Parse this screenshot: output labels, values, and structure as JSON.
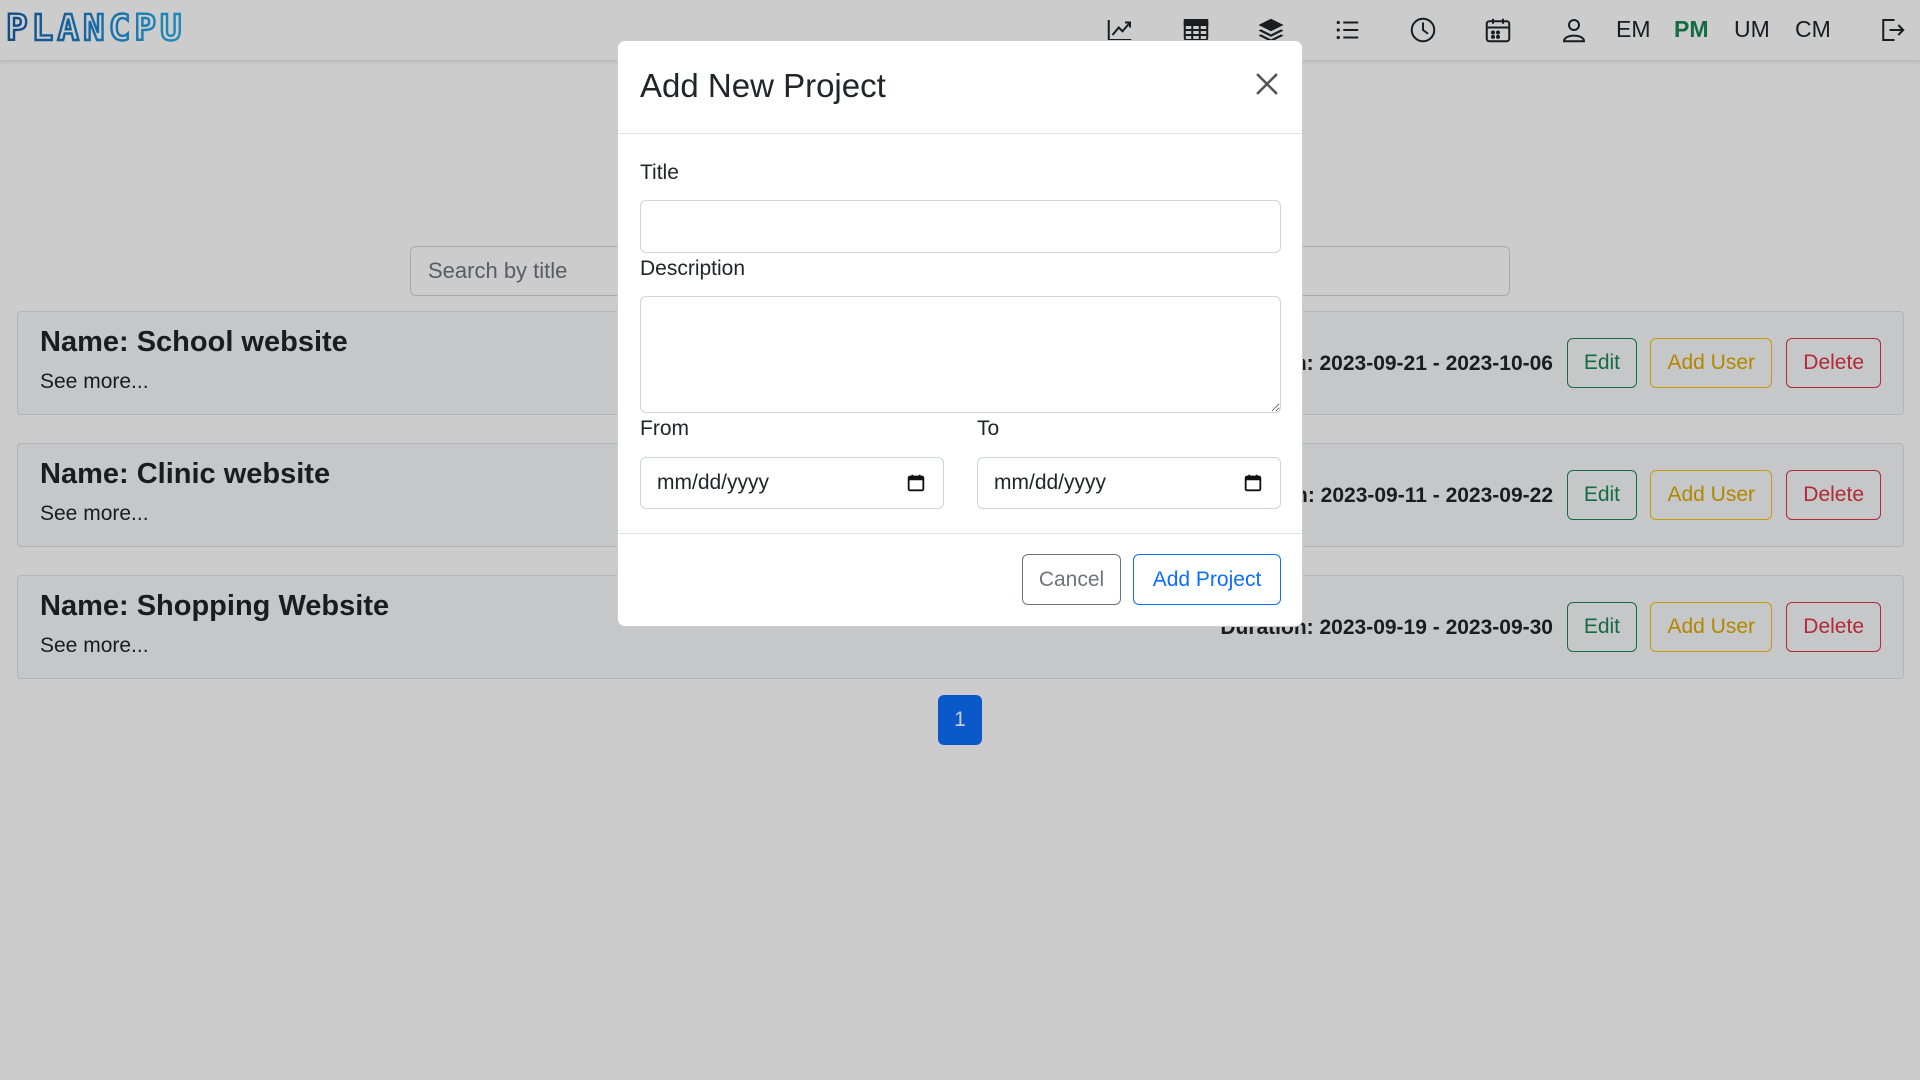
{
  "navbar": {
    "logo_text": "PLANCPU",
    "icons": [
      "chart-line-icon",
      "table-icon",
      "layers-icon",
      "list-icon",
      "clock-icon",
      "calendar-icon",
      "user-icon"
    ],
    "roles": [
      "EM",
      "PM",
      "UM",
      "CM"
    ],
    "active_role": "PM",
    "logout_icon": "logout-icon"
  },
  "search": {
    "placeholder": "Search by title"
  },
  "projects": [
    {
      "name": "Name: School website",
      "more": "See more...",
      "duration": "Duration: 2023-09-21 - 2023-10-06",
      "edit": "Edit",
      "add_user": "Add User",
      "delete": "Delete"
    },
    {
      "name": "Name: Clinic website",
      "more": "See more...",
      "duration": "Duration: 2023-09-11 - 2023-09-22",
      "edit": "Edit",
      "add_user": "Add User",
      "delete": "Delete"
    },
    {
      "name": "Name: Shopping Website",
      "more": "See more...",
      "duration": "Duration: 2023-09-19 - 2023-09-30",
      "edit": "Edit",
      "add_user": "Add User",
      "delete": "Delete"
    }
  ],
  "pagination": {
    "current": "1"
  },
  "modal": {
    "title": "Add New Project",
    "title_label": "Title",
    "title_value": "",
    "description_label": "Description",
    "description_value": "",
    "from_label": "From",
    "from_value": "mm/dd/yyyy",
    "to_label": "To",
    "to_value": "mm/dd/yyyy",
    "cancel": "Cancel",
    "submit": "Add Project"
  },
  "colors": {
    "primary": "#0d6efd",
    "success": "#198754",
    "warning": "#ffc107",
    "danger": "#dc3545",
    "logo": "#1b5fae"
  }
}
